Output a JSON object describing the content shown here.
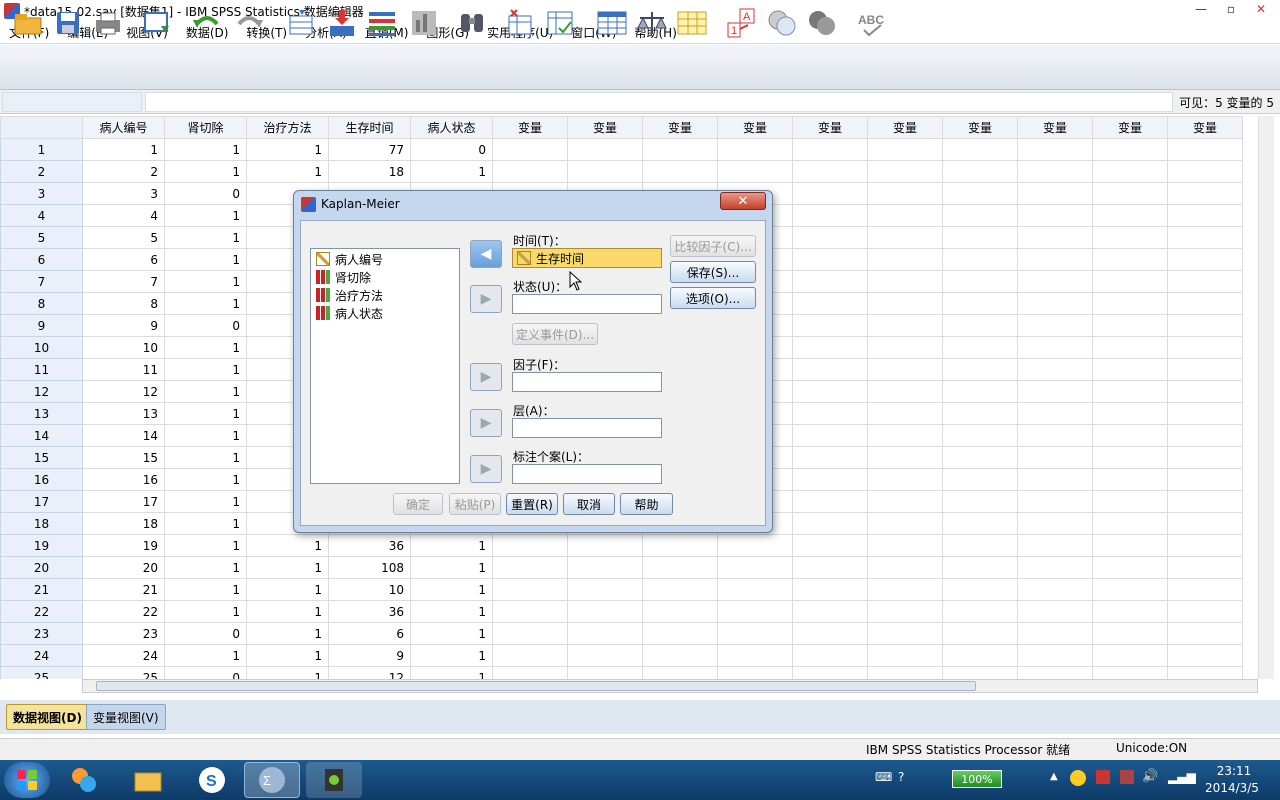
{
  "window": {
    "title": "*data15-02.sav [数据集1] - IBM SPSS Statistics 数据编辑器",
    "minimize": "—",
    "maximize": "▫",
    "close": "✕"
  },
  "menu": [
    "文件(F)",
    "编辑(E)",
    "视图(V)",
    "数据(D)",
    "转换(T)",
    "分析(A)",
    "直销(M)",
    "图形(G)",
    "实用程序(U)",
    "窗口(W)",
    "帮助(H)"
  ],
  "toolbar_icons": [
    "open-icon",
    "save-icon",
    "print-icon",
    "recall-dialog-icon",
    "undo-icon",
    "redo-icon",
    "goto-case-icon",
    "goto-variable-icon",
    "variables-icon",
    "run-descriptives-icon",
    "find-icon",
    "insert-cases-icon",
    "insert-variable-icon",
    "split-file-icon",
    "weight-cases-icon",
    "select-cases-icon",
    "value-labels-icon",
    "use-variable-sets-icon",
    "show-all-variables-icon",
    "spell-check-icon"
  ],
  "status_visible": "可见：5 变量的 5",
  "grid": {
    "headers": [
      "病人编号",
      "肾切除",
      "治疗方法",
      "生存时间",
      "病人状态",
      "变量",
      "变量",
      "变量",
      "变量",
      "变量",
      "变量",
      "变量",
      "变量",
      "变量",
      "变量"
    ],
    "rows": [
      [
        "1",
        "1",
        "1",
        "1",
        "77",
        "0"
      ],
      [
        "2",
        "2",
        "1",
        "1",
        "18",
        "1"
      ],
      [
        "3",
        "3",
        "0",
        "",
        "",
        ""
      ],
      [
        "4",
        "4",
        "1",
        "",
        "",
        ""
      ],
      [
        "5",
        "5",
        "1",
        "",
        "",
        ""
      ],
      [
        "6",
        "6",
        "1",
        "",
        "",
        ""
      ],
      [
        "7",
        "7",
        "1",
        "",
        "",
        ""
      ],
      [
        "8",
        "8",
        "1",
        "",
        "",
        ""
      ],
      [
        "9",
        "9",
        "0",
        "",
        "",
        ""
      ],
      [
        "10",
        "10",
        "1",
        "",
        "",
        ""
      ],
      [
        "11",
        "11",
        "1",
        "",
        "",
        ""
      ],
      [
        "12",
        "12",
        "1",
        "",
        "",
        ""
      ],
      [
        "13",
        "13",
        "1",
        "",
        "",
        ""
      ],
      [
        "14",
        "14",
        "1",
        "",
        "",
        ""
      ],
      [
        "15",
        "15",
        "1",
        "",
        "",
        ""
      ],
      [
        "16",
        "16",
        "1",
        "",
        "",
        ""
      ],
      [
        "17",
        "17",
        "1",
        "",
        "",
        ""
      ],
      [
        "18",
        "18",
        "1",
        "",
        "",
        ""
      ],
      [
        "19",
        "19",
        "1",
        "1",
        "36",
        "1"
      ],
      [
        "20",
        "20",
        "1",
        "1",
        "108",
        "1"
      ],
      [
        "21",
        "21",
        "1",
        "1",
        "10",
        "1"
      ],
      [
        "22",
        "22",
        "1",
        "1",
        "36",
        "1"
      ],
      [
        "23",
        "23",
        "0",
        "1",
        "6",
        "1"
      ],
      [
        "24",
        "24",
        "1",
        "1",
        "9",
        "1"
      ],
      [
        "25",
        "25",
        "0",
        "1",
        "12",
        "1"
      ]
    ]
  },
  "tabs": {
    "data_view": "数据视图(D)",
    "variable_view": "变量视图(V)"
  },
  "statusbar": {
    "processor": "IBM SPSS Statistics Processor 就绪",
    "unicode": "Unicode:ON"
  },
  "dialog": {
    "title": "Kaplan-Meier",
    "close": "✕",
    "variables": [
      {
        "name": "病人编号",
        "icon": "scale-ruler-icon"
      },
      {
        "name": "肾切除",
        "icon": "nominal-bars-icon"
      },
      {
        "name": "治疗方法",
        "icon": "nominal-bars-icon"
      },
      {
        "name": "病人状态",
        "icon": "nominal-bars-icon"
      }
    ],
    "time_label": "时间(T)：",
    "time_value": "生存时间",
    "status_label": "状态(U)：",
    "define_event": "定义事件(D)...",
    "factor_label": "因子(F)：",
    "strata_label": "层(A)：",
    "label_cases_label": "标注个案(L)：",
    "compare_factor": "比较因子(C)...",
    "save": "保存(S)...",
    "options": "选项(O)...",
    "ok": "确定",
    "paste": "粘贴(P)",
    "reset": "重置(R)",
    "cancel": "取消",
    "help": "帮助"
  },
  "taskbar": {
    "battery": "100%",
    "time": "23:11",
    "date": "2014/3/5"
  }
}
